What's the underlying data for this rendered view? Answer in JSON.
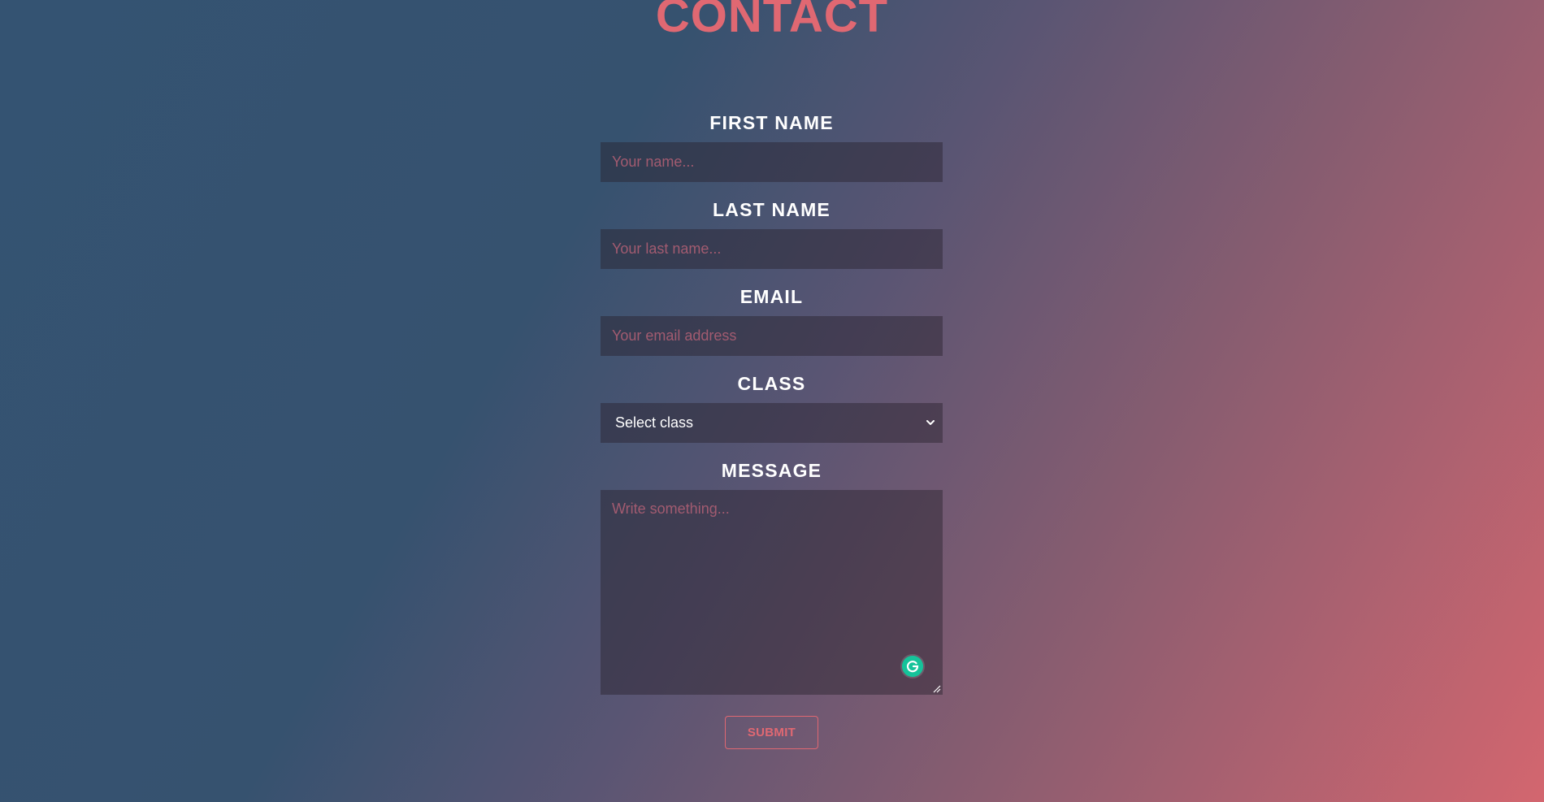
{
  "title": "CONTACT",
  "form": {
    "first_name": {
      "label": "FIRST NAME",
      "placeholder": "Your name..."
    },
    "last_name": {
      "label": "LAST NAME",
      "placeholder": "Your last name..."
    },
    "email": {
      "label": "EMAIL",
      "placeholder": "Your email address"
    },
    "class": {
      "label": "CLASS",
      "selected": "Select class"
    },
    "message": {
      "label": "MESSAGE",
      "placeholder": "Write something..."
    },
    "submit_label": "SUBMIT"
  },
  "colors": {
    "accent": "#e06872",
    "placeholder": "#a25b70",
    "grammarly": "#15c39a",
    "label": "#ffffff"
  },
  "icons": {
    "select_chevron": "chevron-down-icon",
    "grammarly": "grammarly-icon",
    "resize": "resize-handle-icon"
  }
}
